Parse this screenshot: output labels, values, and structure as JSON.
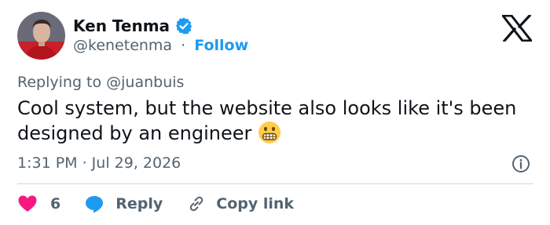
{
  "author": {
    "name": "Ken Tenma",
    "handle": "@kenetenma",
    "separator": "·",
    "follow_label": "Follow"
  },
  "tweet": {
    "replying_to": "Replying to @juanbuis",
    "text": "Cool system, but the website also looks like it's been designed by an engineer",
    "time": "1:31 PM · Jul 29, 2026"
  },
  "actions": {
    "like_count": "6",
    "reply_label": "Reply",
    "copy_label": "Copy link"
  },
  "colors": {
    "accent": "#1d9bf0",
    "like": "#f91880",
    "muted": "#536471",
    "text": "#0f1419"
  },
  "icons": [
    "avatar",
    "verified-badge-icon",
    "x-logo-icon",
    "grimacing-emoji-icon",
    "info-icon",
    "heart-icon",
    "reply-bubble-icon",
    "link-icon"
  ]
}
